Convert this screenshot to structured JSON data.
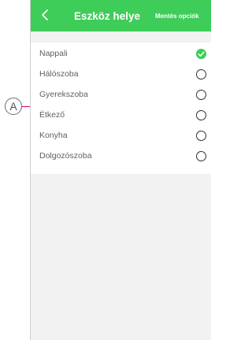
{
  "annotation": {
    "callout_letter": "A"
  },
  "header": {
    "title": "Eszköz helye",
    "save_label": "Mentés opciók",
    "back_icon": "chevron-left-icon",
    "background_color": "#3dcd58"
  },
  "rooms": {
    "items": [
      {
        "label": "Nappali",
        "selected": true
      },
      {
        "label": "Hálószoba",
        "selected": false
      },
      {
        "label": "Gyerekszoba",
        "selected": false
      },
      {
        "label": "Étkező",
        "selected": false
      },
      {
        "label": "Konyha",
        "selected": false
      },
      {
        "label": "Dolgozószoba",
        "selected": false
      }
    ]
  },
  "colors": {
    "accent": "#3dcd58",
    "bracket": "#d3006f",
    "background_gray": "#f2f2f2"
  }
}
